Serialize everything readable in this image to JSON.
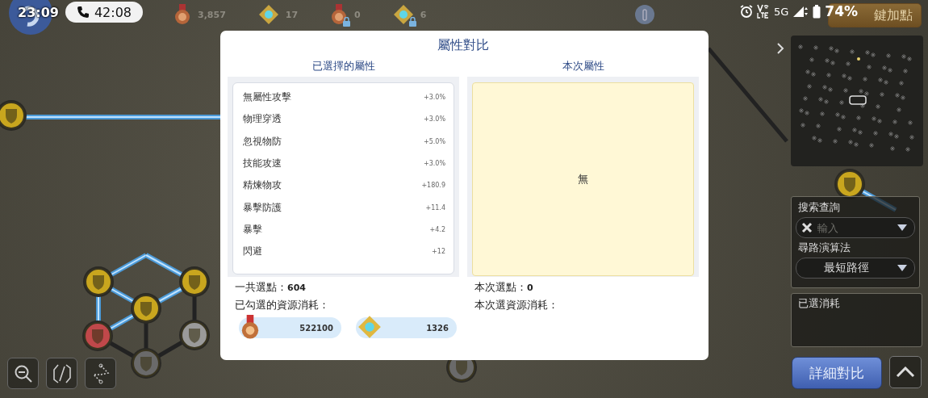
{
  "status_bar": {
    "time": "23:09",
    "call_timer": "42:08",
    "network": "5G",
    "battery": "74%"
  },
  "resources": [
    {
      "kind": "medal",
      "count": "3,857",
      "locked": false
    },
    {
      "kind": "crystal",
      "count": "17",
      "locked": false
    },
    {
      "kind": "medal",
      "count": "0",
      "locked": true
    },
    {
      "kind": "crystal",
      "count": "6",
      "locked": true
    }
  ],
  "auto_assign_button": "鍵加點",
  "dialog": {
    "title": "屬性對比",
    "selected_header": "已選擇的屬性",
    "current_header": "本次屬性",
    "selected_attributes": [
      {
        "name": "無屬性攻擊",
        "value": "+3.0%"
      },
      {
        "name": "物理穿透",
        "value": "+3.0%"
      },
      {
        "name": "忽視物防",
        "value": "+5.0%"
      },
      {
        "name": "技能攻速",
        "value": "+3.0%"
      },
      {
        "name": "精煉物攻",
        "value": "+180.9"
      },
      {
        "name": "暴擊防護",
        "value": "+11.4"
      },
      {
        "name": "暴擊",
        "value": "+4.2"
      },
      {
        "name": "閃避",
        "value": "+12"
      }
    ],
    "current_empty": "無",
    "total_points": {
      "label": "一共選點：",
      "value": "604"
    },
    "cost_label": "已勾選的資源消耗：",
    "costs": [
      {
        "kind": "medal",
        "amount": "522100"
      },
      {
        "kind": "crystal",
        "amount": "1326"
      }
    ],
    "current_points": {
      "label": "本次選點：",
      "value": "0"
    },
    "current_cost_label": "本次選資源消耗："
  },
  "side_panel": {
    "search": {
      "label": "搜索查詢",
      "placeholder": "輸入"
    },
    "algorithm": {
      "label": "尋路演算法",
      "value": "最短路徑"
    },
    "cost_panel_title": "已選消耗",
    "compare_button": "詳細對比"
  }
}
